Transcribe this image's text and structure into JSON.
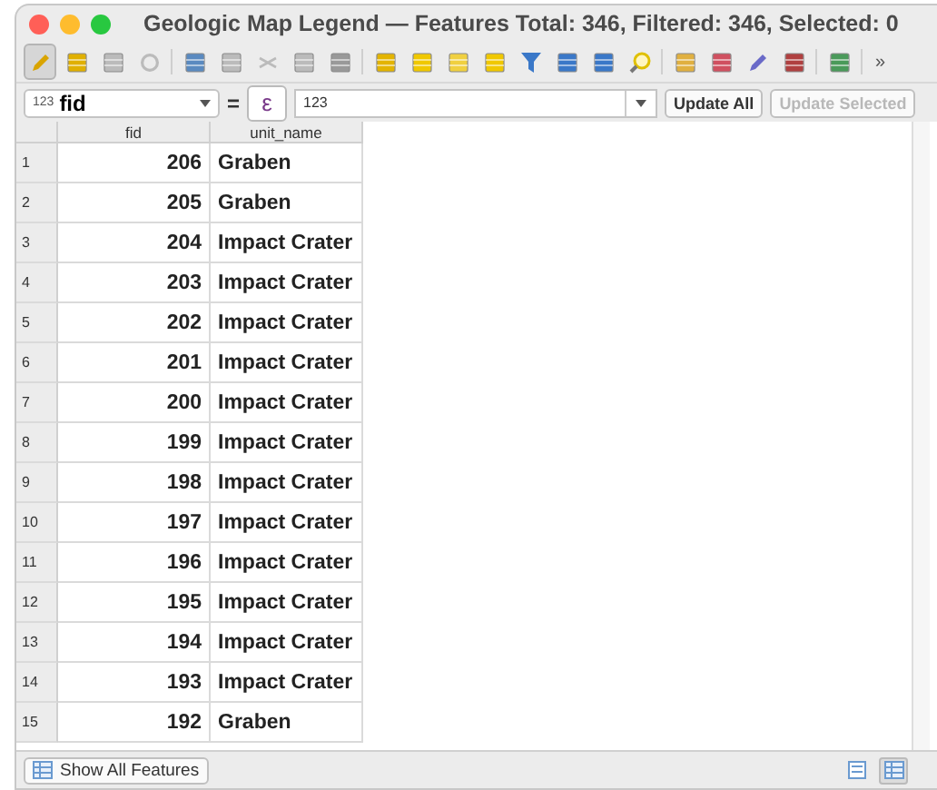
{
  "window": {
    "title": "Geologic Map Legend — Features Total: 346, Filtered: 346, Selected: 0"
  },
  "toolbar": {
    "edit_mode_on": true,
    "overflow": "»"
  },
  "expression_bar": {
    "field_type": "123",
    "field": "fid",
    "operator": "=",
    "expression_button": "ε",
    "value": "123",
    "update_all": "Update All",
    "update_selected": {
      "label": "Update Selected",
      "disabled": true
    }
  },
  "table": {
    "columns": [
      "fid",
      "unit_name"
    ],
    "rows": [
      {
        "number": "1",
        "fid": "206",
        "unit_name": "Graben"
      },
      {
        "number": "2",
        "fid": "205",
        "unit_name": "Graben"
      },
      {
        "number": "3",
        "fid": "204",
        "unit_name": "Impact Crater"
      },
      {
        "number": "4",
        "fid": "203",
        "unit_name": "Impact Crater"
      },
      {
        "number": "5",
        "fid": "202",
        "unit_name": "Impact Crater"
      },
      {
        "number": "6",
        "fid": "201",
        "unit_name": "Impact Crater"
      },
      {
        "number": "7",
        "fid": "200",
        "unit_name": "Impact Crater"
      },
      {
        "number": "8",
        "fid": "199",
        "unit_name": "Impact Crater"
      },
      {
        "number": "9",
        "fid": "198",
        "unit_name": "Impact Crater"
      },
      {
        "number": "10",
        "fid": "197",
        "unit_name": "Impact Crater"
      },
      {
        "number": "11",
        "fid": "196",
        "unit_name": "Impact Crater"
      },
      {
        "number": "12",
        "fid": "195",
        "unit_name": "Impact Crater"
      },
      {
        "number": "13",
        "fid": "194",
        "unit_name": "Impact Crater"
      },
      {
        "number": "14",
        "fid": "193",
        "unit_name": "Impact Crater"
      },
      {
        "number": "15",
        "fid": "192",
        "unit_name": "Graben"
      }
    ]
  },
  "status_bar": {
    "filter_button": "Show All Features",
    "table_view_selected": true
  }
}
